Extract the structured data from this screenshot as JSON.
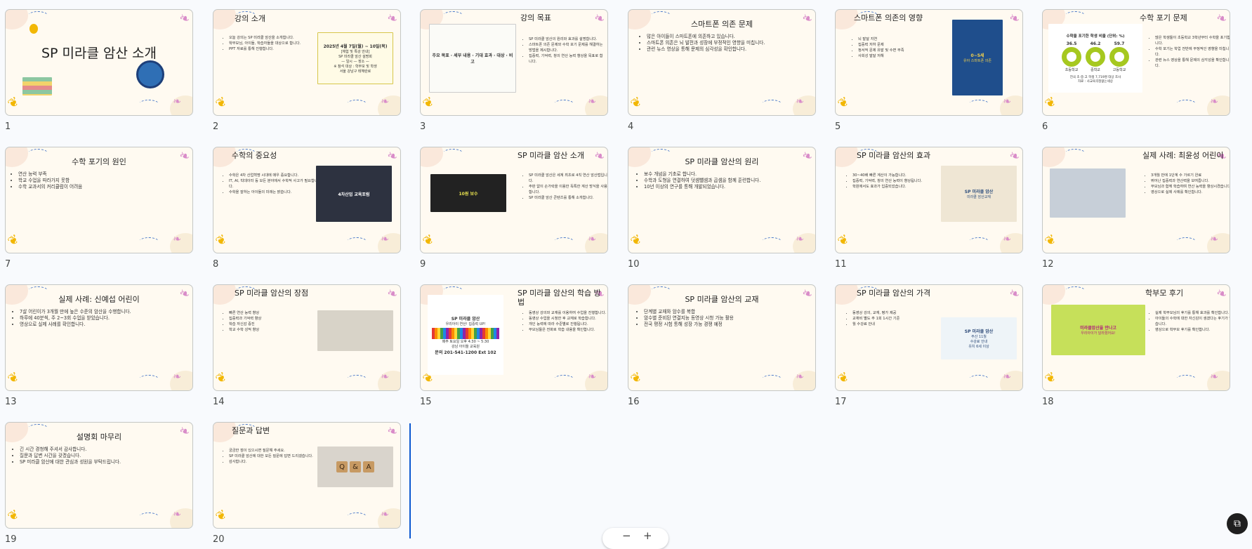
{
  "colors": {
    "background": "#f8fafd",
    "slide": "#fffaf1",
    "accent": "#0b57d0",
    "leaf_yellow": "#f2b705",
    "leaf_pink": "#d98cc9",
    "leaf_green": "#5a8c3a"
  },
  "slides": [
    {
      "num": "1",
      "title": "SP 미라클 암산 소개",
      "bullets": []
    },
    {
      "num": "2",
      "title": "강의 소개",
      "bullets": [
        "오늘 강의는 SP 미라클 암산을 소개합니다.",
        "학부모님, 아이들, 학습자들을 대상으로 합니다.",
        "PPT 자료를 통해 진행합니다."
      ],
      "image_text": [
        "2025년 4월 7일(월) ~ 10일(목)",
        "[체험 및 특강 안내]",
        "SP 미라클 암산 설명회",
        "— 일시 — 장소 —",
        "※ 참석 대상 : 학부모 및 학생",
        "서울 강남구 테헤란로"
      ]
    },
    {
      "num": "3",
      "title": "강의 목표",
      "bullets": [
        "SP 미라클 암산의 원리와 효과를 설명합니다.",
        "스마트폰 의존 문제와 수학 포기 문제를 해결하는 방법을 제시합니다.",
        "집중력, 기억력, 창의 연산 능력 향상을 목표로 합니다."
      ],
      "image_text": [
        "주요 목표 · 세부 내용 · 기대 효과 · 대상 · 비고"
      ]
    },
    {
      "num": "4",
      "title": "스마트폰 의존 문제",
      "bullets": [
        "많은 아이들이 스마트폰에 의존하고 있습니다.",
        "스마트폰 의존은 뇌 발전과 성장에 부정적인 영향을 미칩니다.",
        "관련 뉴스 영상을 통해 문제의 심각성을 확인합니다."
      ]
    },
    {
      "num": "5",
      "title": "스마트폰 의존의 영향",
      "bullets": [
        "뇌 발달 지연",
        "집중력 저하 문제",
        "정서적 문제 유발 및 수면 부족",
        "사회성 발달 저해"
      ],
      "image_text": [
        "0~5세",
        "유아 스마트폰 의존"
      ]
    },
    {
      "num": "6",
      "title": "수학 포기 문제",
      "bullets": [
        "많은 학생들이 초등학교 3학년부터 수학을 포기합니다.",
        "수학 포기는 학업 전반에 부정적인 영향을 미칩니다.",
        "관련 뉴스 영상을 통해 문제의 심각성을 확인합니다."
      ],
      "image_text": [
        "수학을 포기한 학생 비율 (단위: %)",
        "36.5",
        "46.2",
        "59.7",
        "초등학교",
        "중학교",
        "고등학교",
        "전국 초·중·고 학생 7,719명 대상 조사",
        "자료 : 사교육걱정없는세상"
      ]
    },
    {
      "num": "7",
      "title": "수학 포기의 원인",
      "bullets": [
        "연산 능력 부족",
        "학교 수업을 따라가지 못함",
        "수학 교과서의 커리큘럼이 어려움"
      ]
    },
    {
      "num": "8",
      "title": "수학의 중요성",
      "bullets": [
        "수학은 4차 산업혁명 시대에 매우 중요합니다.",
        "IT, AI, 빅데이터 등 모든 분야에서 수학적 사고가 필요합니다.",
        "수학을 잘하는 아이들의 미래는 밝습니다."
      ],
      "image_text": [
        "4차산업 교육포럼"
      ]
    },
    {
      "num": "9",
      "title": "SP 미라클 암산 소개",
      "bullets": [
        "SP 미라클 암산은 세계 최초로 4칙 연산 암산법입니다.",
        "주판 없이 손가락을 이용한 독특한 계산 방식을 사용합니다.",
        "SP 미라클 암산 콘텐츠를 통해 소개합니다."
      ],
      "image_text": [
        "10원 보수"
      ]
    },
    {
      "num": "10",
      "title": "SP 미라클 암산의 원리",
      "bullets": [
        "보수 개념을 기초로 합니다.",
        "수학과 도형을 연결하여 덧셈뺄셈과 곱셈을 함께 훈련합니다.",
        "10년 이상의 연구를 통해 개발되었습니다."
      ]
    },
    {
      "num": "11",
      "title": "SP 미라클 암산의 효과",
      "bullets": [
        "30~40배 빠른 계산이 가능합니다.",
        "집중력, 기억력, 창의 연산 능력이 향상됩니다.",
        "학원에서도 효과가 입증되었습니다."
      ],
      "image_text": [
        "SP 미라클 암산",
        "미라클 암산교재"
      ]
    },
    {
      "num": "12",
      "title": "실제 사례: 최윤성 어린이",
      "bullets": [
        "3개월 만에 1단계 수 가르기 완료",
        "뛰어난 집중력과 연산력을 보여줍니다.",
        "부모님과 함께 학습하며 연산 능력을 향상시켰습니다.",
        "영상으로 실제 사례를 확인합니다."
      ]
    },
    {
      "num": "13",
      "title": "실제 사례: 신예섭 어린이",
      "bullets": [
        "7살 어린이가 3개월 만에 높은 수준의 암산을 수행합니다.",
        "하루에 40분씩, 주 2~3회 수업을 받았습니다.",
        "영상으로 실제 사례를 확인합니다."
      ]
    },
    {
      "num": "14",
      "title": "SP 미라클 암산의 장점",
      "bullets": [
        "빠른 연산 능력 향상",
        "집중력과 기억력 향상",
        "학습 자신감 증진",
        "학교 수학 성적 향상"
      ]
    },
    {
      "num": "15",
      "title": "SP 미라클 암산의 학습 방법",
      "bullets": [
        "동영상 강의와 교재를 이용하여 수업을 진행합니다.",
        "동영상 수업을 시청한 후 교재로 학습합니다.",
        "개인 능력에 따라 수준별로 진행됩니다.",
        "부모님들은 전화로 학습 내용을 확인합니다."
      ],
      "image_text": [
        "SP 미라클 암산",
        "우리아이 연산! 집중력 UP!",
        "매주 토요일 오후 4:30 ~ 5:30",
        "강남 아이들 교육원",
        "문의 201-541-1200 Ext 102"
      ]
    },
    {
      "num": "16",
      "title": "SP 미라클 암산의 교재",
      "bullets": [
        "단계별 교재와 암수를 복합",
        "암수별 준비된 연결지능 동영상 시청 가능 활용",
        "전국 평정 시험 통해 성장 가능 경쟁 예정"
      ]
    },
    {
      "num": "17",
      "title": "SP 미라클 암산의 가격",
      "bullets": [
        "동영상 강의, 교재, 평가 제공",
        "교재비 별도 주 1회 1시간 기준",
        "월 수강료 안내"
      ],
      "image_text": [
        "SP 미라클 암산",
        "주산 11월",
        "수강료 안내",
        "유치 6세 이상"
      ]
    },
    {
      "num": "18",
      "title": "학부모 후기",
      "bullets": [
        "실제 학부모님의 후기를 통해 효과를 확인합니다.",
        "아이들의 수학에 대한 자신감이 생겼다는 후기가 많습니다.",
        "영상으로 학부모 후기를 확인합니다."
      ],
      "image_text": [
        "미라클암산을 만나고",
        "우리아이가 달라졌어요!"
      ]
    },
    {
      "num": "19",
      "title": "설명회 마무리",
      "bullets": [
        "긴 시간 경청해 주셔서 감사합니다.",
        "질문과 답변 시간을 갖겠습니다.",
        "SP 미라클 암산에 대한 관심과 성원을 부탁드립니다."
      ]
    },
    {
      "num": "20",
      "title": "질문과 답변",
      "bullets": [
        "궁금한 점이 있으시면 질문해 주세요.",
        "SP 미라클 암산에 대한 모든 질문에 답변 드리겠습니다.",
        "감사합니다."
      ],
      "image_text": [
        "Q",
        "&",
        "A"
      ]
    }
  ],
  "zoom": {
    "minus": "−",
    "plus": "+"
  },
  "assistant": {
    "icon": "sparkle-chat-icon",
    "glyph": "⧉"
  }
}
